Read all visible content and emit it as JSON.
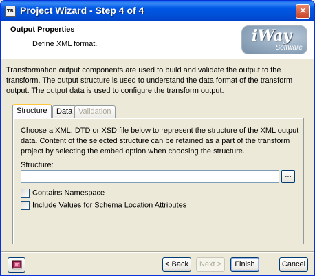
{
  "window": {
    "title": "Project Wizard - Step 4 of 4",
    "app_icon_text": "TR",
    "close_glyph": "✕"
  },
  "header": {
    "title": "Output Properties",
    "subtitle": "Define XML format.",
    "logo_main": "iWay",
    "logo_sub": "Software"
  },
  "description": "Transformation output components are used to build and validate the output to the transform. The output structure is used to understand the data format of the transform output. The output data is used to configure the transform output.",
  "tabs": [
    {
      "label": "Structure",
      "state": "active"
    },
    {
      "label": "Data",
      "state": "normal"
    },
    {
      "label": "Validation",
      "state": "disabled"
    }
  ],
  "panel": {
    "description": "Choose a XML, DTD or XSD file below to represent the structure of the XML output data. Content of the selected structure can be retained as a part of the transform project by selecting the embed option when choosing the structure.",
    "structure_label": "Structure:",
    "structure_value": "",
    "browse_label": "...",
    "checkboxes": [
      {
        "label": "Contains Namespace",
        "checked": false
      },
      {
        "label": "Include Values for Schema Location Attributes",
        "checked": false
      }
    ]
  },
  "footer": {
    "back_label": "< Back",
    "next_label": "Next >",
    "finish_label": "Finish",
    "cancel_label": "Cancel"
  },
  "colors": {
    "titlebar": "#0058e6",
    "accent_tab": "#ffc83c",
    "dialog_bg": "#ece9d8"
  }
}
